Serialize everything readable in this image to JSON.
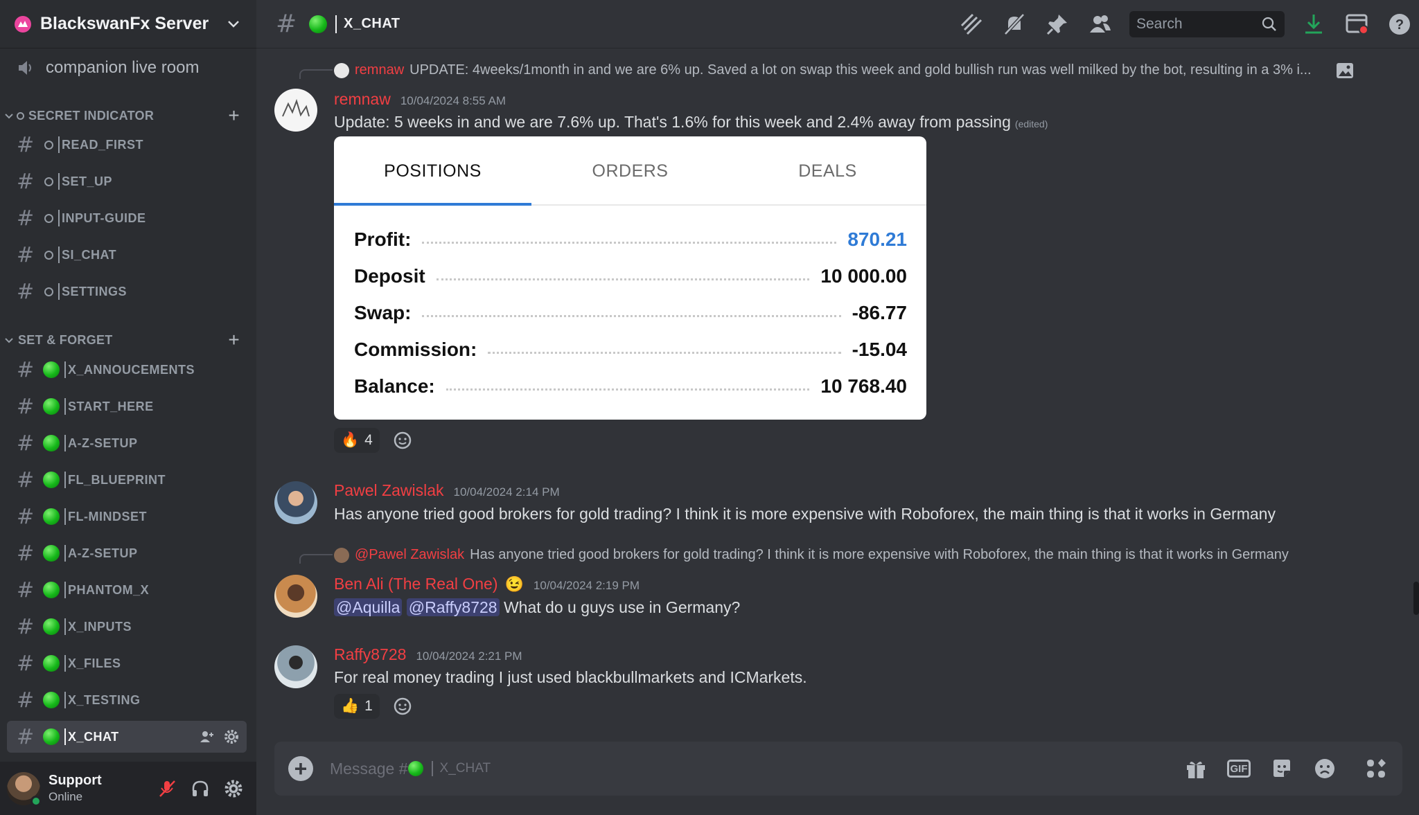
{
  "server": {
    "name": "BlackswanFx Server"
  },
  "voice_channel": {
    "label": "companion live room"
  },
  "categories": [
    {
      "label": "SECRET INDICATOR",
      "channels": [
        "READ_FIRST",
        "SET_UP",
        "INPUT-GUIDE",
        "SI_CHAT",
        "SETTINGS"
      ]
    },
    {
      "label": "SET & FORGET",
      "channels": [
        "X_ANNOUCEMENTS",
        "START_HERE",
        "A-Z-SETUP",
        "FL_BLUEPRINT",
        "FL-MINDSET",
        "A-Z-SETUP",
        "PHANTOM_X",
        "X_INPUTS",
        "X_FILES",
        "X_TESTING",
        "X_CHAT"
      ]
    }
  ],
  "user": {
    "name": "Support",
    "status": "Online"
  },
  "topbar": {
    "channel_name": "X_CHAT",
    "search_placeholder": "Search"
  },
  "messages": [
    {
      "reply": {
        "author": "remnaw",
        "text": "UPDATE: 4weeks/1month in and we are 6% up. Saved a lot on swap this week and gold bullish run was well milked by the bot, resulting in a 3% i..."
      },
      "author": "remnaw",
      "timestamp": "10/04/2024 8:55 AM",
      "text": "Update: 5 weeks in and we are 7.6% up. That's 1.6% for this week and 2.4% away from passing",
      "edited": "(edited)",
      "attachment": {
        "tabs": [
          "POSITIONS",
          "ORDERS",
          "DEALS"
        ],
        "rows": [
          {
            "label": "Profit:",
            "value": "870.21"
          },
          {
            "label": "Deposit",
            "value": "10 000.00"
          },
          {
            "label": "Swap:",
            "value": "-86.77"
          },
          {
            "label": "Commission:",
            "value": "-15.04"
          },
          {
            "label": "Balance:",
            "value": "10 768.40"
          }
        ]
      },
      "reaction": {
        "emoji": "🔥",
        "count": "4"
      }
    },
    {
      "author": "Pawel Zawislak",
      "timestamp": "10/04/2024 2:14 PM",
      "text": "Has anyone tried good brokers for gold trading? I think it is more expensive with Roboforex, the main thing is that it works in Germany"
    },
    {
      "reply": {
        "author": "@Pawel Zawislak",
        "text": "Has anyone tried good brokers for gold trading? I think it is more expensive with Roboforex, the main thing is that it works in Germany"
      },
      "author": "Ben Ali (The Real One)",
      "author_emoji": "😉",
      "timestamp": "10/04/2024 2:19 PM",
      "mentions": [
        "@Aquilla",
        "@Raffy8728"
      ],
      "text": "What do u guys use in Germany?"
    },
    {
      "author": "Raffy8728",
      "timestamp": "10/04/2024 2:21 PM",
      "text": "For real money trading I just used blackbullmarkets and ICMarkets.",
      "reaction": {
        "emoji": "👍",
        "count": "1"
      }
    }
  ],
  "composer": {
    "prefix": "Message #",
    "channel": "X_CHAT",
    "gif_label": "GIF"
  },
  "colors": {
    "author": "#f23f43",
    "accent_blue": "#2f7bd6",
    "online": "#23a55a",
    "download": "#23a55a"
  }
}
